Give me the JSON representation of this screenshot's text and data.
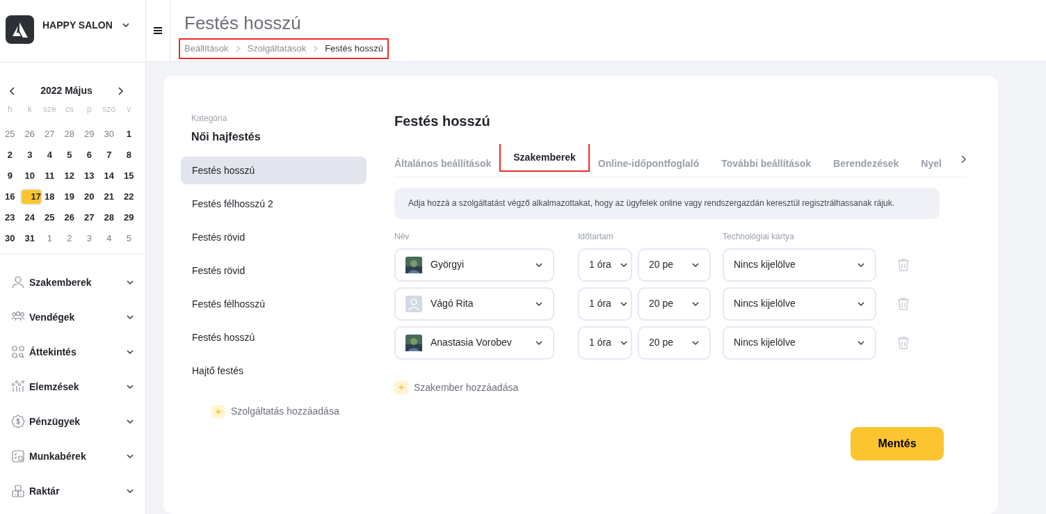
{
  "brand": {
    "name": "HAPPY SALON"
  },
  "header": {
    "title": "Festés hosszú",
    "highlighted": true,
    "breadcrumb": [
      {
        "label": "Beállítások",
        "current": false
      },
      {
        "label": "Szolgáltatások",
        "current": false
      },
      {
        "label": "Festés hosszú",
        "current": true
      }
    ]
  },
  "calendar": {
    "month": "2022 Május",
    "weekdays": [
      "h",
      "k",
      "sze",
      "cs",
      "p",
      "szo",
      "v"
    ],
    "weeks": [
      [
        {
          "day": "25",
          "muted": true,
          "selected": false
        },
        {
          "day": "26",
          "muted": true,
          "selected": false
        },
        {
          "day": "27",
          "muted": true,
          "selected": false
        },
        {
          "day": "28",
          "muted": true,
          "selected": false
        },
        {
          "day": "29",
          "muted": true,
          "selected": false
        },
        {
          "day": "30",
          "muted": true,
          "selected": false
        },
        {
          "day": "1",
          "muted": false,
          "selected": false
        }
      ],
      [
        {
          "day": "2",
          "muted": false,
          "selected": false
        },
        {
          "day": "3",
          "muted": false,
          "selected": false
        },
        {
          "day": "4",
          "muted": false,
          "selected": false
        },
        {
          "day": "5",
          "muted": false,
          "selected": false
        },
        {
          "day": "6",
          "muted": false,
          "selected": false
        },
        {
          "day": "7",
          "muted": false,
          "selected": false
        },
        {
          "day": "8",
          "muted": false,
          "selected": false
        }
      ],
      [
        {
          "day": "9",
          "muted": false,
          "selected": false
        },
        {
          "day": "10",
          "muted": false,
          "selected": false
        },
        {
          "day": "11",
          "muted": false,
          "selected": false
        },
        {
          "day": "12",
          "muted": false,
          "selected": false
        },
        {
          "day": "13",
          "muted": false,
          "selected": false
        },
        {
          "day": "14",
          "muted": false,
          "selected": false
        },
        {
          "day": "15",
          "muted": false,
          "selected": false
        }
      ],
      [
        {
          "day": "16",
          "muted": false,
          "selected": false
        },
        {
          "day": "17",
          "muted": false,
          "selected": true
        },
        {
          "day": "18",
          "muted": false,
          "selected": false
        },
        {
          "day": "19",
          "muted": false,
          "selected": false
        },
        {
          "day": "20",
          "muted": false,
          "selected": false
        },
        {
          "day": "21",
          "muted": false,
          "selected": false
        },
        {
          "day": "22",
          "muted": false,
          "selected": false
        }
      ],
      [
        {
          "day": "23",
          "muted": false,
          "selected": false
        },
        {
          "day": "24",
          "muted": false,
          "selected": false
        },
        {
          "day": "25",
          "muted": false,
          "selected": false
        },
        {
          "day": "26",
          "muted": false,
          "selected": false
        },
        {
          "day": "27",
          "muted": false,
          "selected": false
        },
        {
          "day": "28",
          "muted": false,
          "selected": false
        },
        {
          "day": "29",
          "muted": false,
          "selected": false
        }
      ],
      [
        {
          "day": "30",
          "muted": false,
          "selected": false
        },
        {
          "day": "31",
          "muted": false,
          "selected": false
        },
        {
          "day": "1",
          "muted": true,
          "selected": false
        },
        {
          "day": "2",
          "muted": true,
          "selected": false
        },
        {
          "day": "3",
          "muted": true,
          "selected": false
        },
        {
          "day": "4",
          "muted": true,
          "selected": false
        },
        {
          "day": "5",
          "muted": true,
          "selected": false
        }
      ]
    ]
  },
  "nav": [
    {
      "label": "Szakemberek"
    },
    {
      "label": "Vendégek"
    },
    {
      "label": "Áttekintés"
    },
    {
      "label": "Elemzések"
    },
    {
      "label": "Pénzügyek"
    },
    {
      "label": "Munkabérek"
    },
    {
      "label": "Raktár"
    }
  ],
  "category": {
    "label": "Kategória",
    "name": "Női hajfestés"
  },
  "services": [
    {
      "label": "Festés hosszú",
      "selected": true
    },
    {
      "label": "Festés félhosszú 2",
      "selected": false
    },
    {
      "label": "Festés rövid",
      "selected": false
    },
    {
      "label": "Festés rövid",
      "selected": false
    },
    {
      "label": "Festés félhosszú",
      "selected": false
    },
    {
      "label": "Festés hosszú",
      "selected": false
    },
    {
      "label": "Hajtő festés",
      "selected": false
    }
  ],
  "add_service": "Szolgáltatás hozzáadása",
  "content": {
    "title": "Festés hosszú",
    "tabs": [
      {
        "label": "Általános beállítások",
        "selected": false,
        "highlighted": false
      },
      {
        "label": "Szakemberek",
        "selected": true,
        "highlighted": true
      },
      {
        "label": "Online-időpontfoglaló",
        "selected": false,
        "highlighted": false
      },
      {
        "label": "További beállítások",
        "selected": false,
        "highlighted": false
      },
      {
        "label": "Berendezések",
        "selected": false,
        "highlighted": false
      },
      {
        "label": "Nyel",
        "selected": false,
        "highlighted": false
      }
    ],
    "info": "Adja hozzá a szolgáltatást végző alkalmazottakat, hogy az ügyfelek online vagy rendszergazdán keresztül regisztrálhassanak rájuk.",
    "columns": [
      "Név",
      "Időtartam",
      "Technológiai kártya"
    ],
    "rows": [
      {
        "name": "Györgyi",
        "hours": "1 óra",
        "minutes": "20 pe",
        "card": "Nincs kijelölve"
      },
      {
        "name": "Vágó Rita",
        "kind": "placeholder",
        "hours": "1 óra",
        "minutes": "20 pe",
        "card": "Nincs kijelölve"
      },
      {
        "name": "Anastasia Vorobev",
        "hours": "1 óra",
        "minutes": "20 pe",
        "card": "Nincs kijelölve"
      }
    ],
    "add_staff": "Szakember hozzáadása",
    "save": "Mentés"
  }
}
